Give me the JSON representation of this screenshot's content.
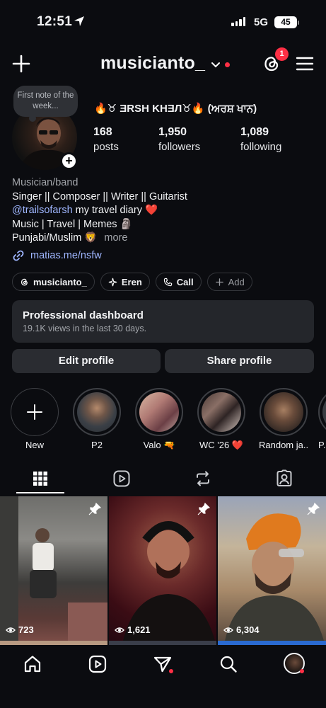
{
  "status_bar": {
    "time": "12:51",
    "network": "5G",
    "battery": "45"
  },
  "header": {
    "username": "musicianto_",
    "notifications_count": "1"
  },
  "profile": {
    "note": "First note of the week...",
    "full_name": "🔥♉ ƎRSH KHƎЛ♉🔥 (ਅਰਸ਼ ਖਾਨ)",
    "stats": [
      {
        "value": "168",
        "label": "posts"
      },
      {
        "value": "1,950",
        "label": "followers"
      },
      {
        "value": "1,089",
        "label": "following"
      }
    ]
  },
  "bio": {
    "category": "Musician/band",
    "line1": "Singer || Composer || Writer || Guitarist",
    "mention": "@trailsofarsh",
    "line2_rest": " my travel diary ❤️",
    "line3": "Music | Travel | Memes 🗿",
    "line4": "Punjabi/Muslim 🦁",
    "more": "more",
    "link": "matias.me/nsfw"
  },
  "chips": [
    {
      "label": "musicianto_",
      "icon": "threads-icon"
    },
    {
      "label": "Eren",
      "icon": "sparkle-icon"
    },
    {
      "label": "Call",
      "icon": "phone-icon"
    },
    {
      "label": "Add",
      "icon": "plus-icon"
    }
  ],
  "dashboard": {
    "title": "Professional dashboard",
    "subtitle": "19.1K views in the last 30 days."
  },
  "buttons": {
    "edit": "Edit profile",
    "share": "Share profile"
  },
  "highlights": [
    {
      "label": "New"
    },
    {
      "label": "P2"
    },
    {
      "label": "Valo 🔫"
    },
    {
      "label": "WC '26 ❤️"
    },
    {
      "label": "Random ja..."
    },
    {
      "label": "P..."
    }
  ],
  "posts": [
    {
      "views": "723",
      "pinned": true
    },
    {
      "views": "1,621",
      "pinned": true
    },
    {
      "views": "6,304",
      "pinned": true
    }
  ],
  "colors": {
    "background": "#0b0c10",
    "accent_red": "#ff2f45",
    "link_blue": "#9fb6ff",
    "card": "#24262b"
  }
}
